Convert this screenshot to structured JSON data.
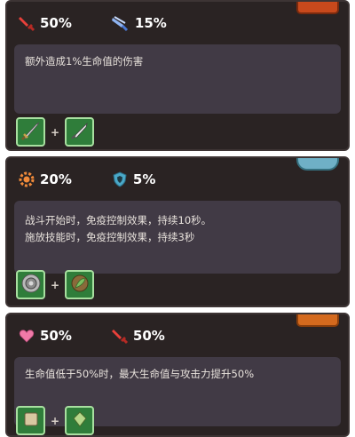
{
  "cards": [
    {
      "title": "",
      "stats": [
        {
          "value": "50%",
          "icon": "red-sword-icon"
        },
        {
          "value": "15%",
          "icon": "blue-feather-icon"
        }
      ],
      "description": [
        "额外造成1%生命值的伤害"
      ],
      "items": [
        "sword-item-icon",
        "spear-tip-item-icon"
      ]
    },
    {
      "title": "",
      "stats": [
        {
          "value": "20%",
          "icon": "orange-gear-icon"
        },
        {
          "value": "5%",
          "icon": "blue-shield-icon"
        }
      ],
      "description": [
        "战斗开始时，免疫控制效果，持续10秒。",
        "施放技能时，免疫控制效果，持续3秒"
      ],
      "items": [
        "round-shield-item-icon",
        "leaf-charm-item-icon"
      ]
    },
    {
      "title": "",
      "stats": [
        {
          "value": "50%",
          "icon": "pink-heart-icon"
        },
        {
          "value": "50%",
          "icon": "red-sword-icon"
        }
      ],
      "description": [
        "生命值低于50%时，最大生命值与攻击力提升50%"
      ],
      "items": [
        "scroll-item-icon",
        "gem-item-icon"
      ]
    }
  ],
  "colors": {
    "card_bg": "#2a2323",
    "desc_bg": "#413a45",
    "stat_text": "#ffffff",
    "item_slot": "#2f7d3a"
  }
}
